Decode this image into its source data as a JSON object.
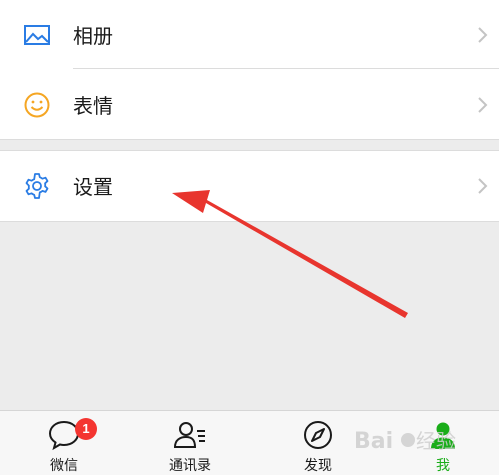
{
  "menu": {
    "album_label": "相册",
    "emoji_label": "表情",
    "settings_label": "设置"
  },
  "tabbar": {
    "chats_label": "微信",
    "chats_badge": "1",
    "contacts_label": "通讯录",
    "discover_label": "发现",
    "me_label": "我"
  },
  "watermark": {
    "text": "Baidu经验"
  },
  "colors": {
    "album_icon": "#2a7ce4",
    "emoji_icon": "#f5a623",
    "settings_icon": "#2a7ce4",
    "arrow": "#e8352e",
    "active_tab": "#1aad19",
    "badge": "#f43530"
  }
}
